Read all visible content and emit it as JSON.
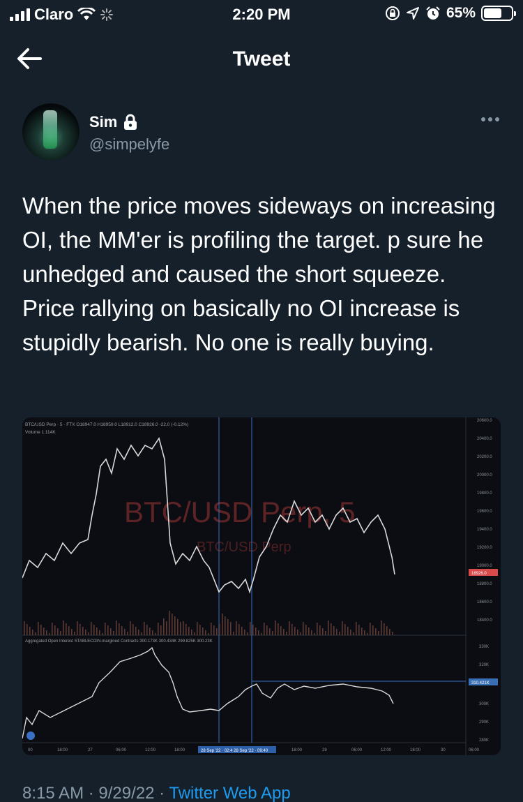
{
  "status_bar": {
    "carrier": "Claro",
    "time": "2:20 PM",
    "battery": "65%",
    "battery_level": 0.65
  },
  "header": {
    "title": "Tweet"
  },
  "author": {
    "name": "Sim",
    "handle": "@simpelyfe"
  },
  "tweet": {
    "text": "When the price moves sideways on increasing OI, the MM'er is profiling the target. p sure he unhedged and caused the short squeeze. Price rallying on basically no OI increase is stupidly bearish. No one is really buying.",
    "timestamp": "8:15 AM · 9/29/22 · ",
    "source": "Twitter Web App"
  },
  "chart": {
    "symbol_line": "BTC/USD Perp · 5 · FTX",
    "ohlc": "O18947.0 H18950.0 L18912.0 C18926.0 -22.0 (-0.12%)",
    "volume": "Volume 1.114K",
    "watermark_big": "BTC/USD Perp, 5",
    "watermark_small": "BTC/USD Perp",
    "oi_title": "Aggregated Open Interest STABLECOIN-margined Contracts",
    "oi_values": "300.173K 300.434K 299.825K 300.23K",
    "price_ticks": [
      "20600.0",
      "20400.0",
      "20200.0",
      "20000.0",
      "19800.0",
      "19600.0",
      "19400.0",
      "19200.0",
      "19000.0",
      "18800.0",
      "18600.0",
      "18400.0"
    ],
    "price_current": "18926.0",
    "oi_ticks": [
      "330K",
      "320K",
      "300K",
      "290K",
      "280K"
    ],
    "oi_current": "310.421K",
    "time_ticks": [
      "00",
      "18:00",
      "27",
      "06:00",
      "12:00",
      "18:00",
      "18:00",
      "29",
      "06:00",
      "12:00",
      "18:00",
      "30",
      "06:00"
    ],
    "range_label_1": "28 Sep '22 · 02:4",
    "range_label_2": "28 Sep '22 · 09:40"
  },
  "colors": {
    "background": "#15202b",
    "secondary_text": "#8899a6",
    "accent": "#1d9bf0",
    "candle_up": "#d9d9d9",
    "watermark": "#7a2b2b",
    "price_badge": "#d94a4a",
    "oi_badge": "#3b6fb5"
  }
}
